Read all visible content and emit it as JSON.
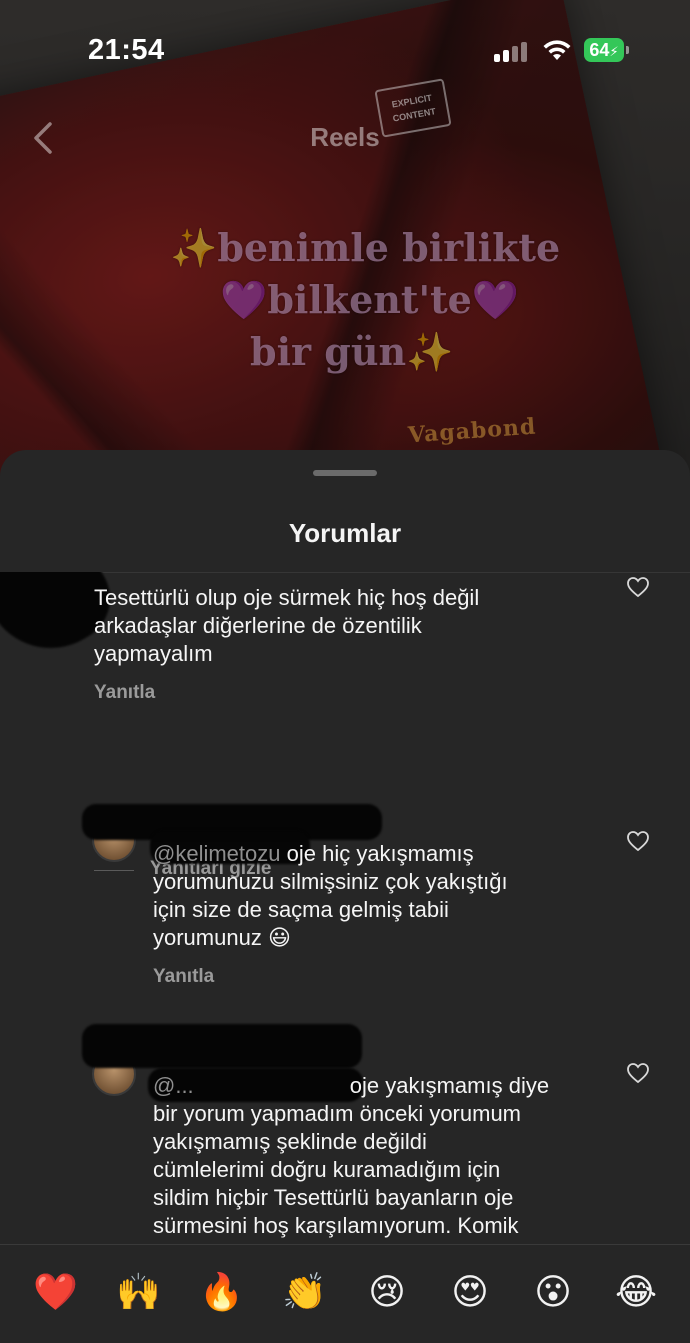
{
  "status_bar": {
    "time": "21:54",
    "battery": "64"
  },
  "nav": {
    "title": "Reels"
  },
  "reel": {
    "badge_line1": "EXPLICIT",
    "badge_line2": "CONTENT",
    "overlay_line1": "✨benimle birlikte",
    "overlay_line2": "💜bilkent'te💜",
    "overlay_line3": "bir gün✨",
    "book_mark": "Vagabond"
  },
  "comments_sheet": {
    "title": "Yorumlar",
    "hide_replies": "Yanıtları gizle",
    "comments": [
      {
        "text": "Tesettürlü olup oje sürmek hiç hoş değil\narkadaşlar diğerlerine de özentilik\nyapmayalım",
        "reply": "Yanıtla"
      },
      {
        "mention": "@kelimetozu",
        "text": " oje hiç yakışmamış\nyorumunuzu silmişsiniz çok yakıştığı\niçin size de saçma gelmiş tabii\nyorumunuz 😃",
        "reply": "Yanıtla"
      },
      {
        "mention": "@...",
        "text": " oje yakışmamış diye\nbir yorum yapmadım önceki yorumum\nyakışmamış şeklinde değildi\ncümlelerimi doğru kuramadığım için\nsildim hiçbir Tesettürlü bayanların oje\nsürmesini hoş karşılamıyorum. Komik"
      }
    ]
  },
  "reactions": [
    "❤️",
    "🙌",
    "🔥",
    "👏",
    "😢",
    "😍",
    "😮",
    "😂"
  ],
  "colors": {
    "sheet_bg": "#262626",
    "battery": "#34c759",
    "text_primary": "#f5f5f5",
    "text_secondary": "#9a9a9a"
  }
}
